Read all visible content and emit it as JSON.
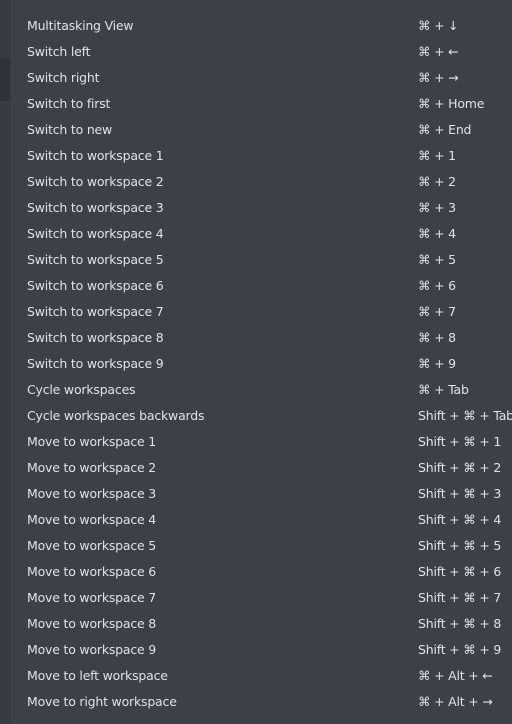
{
  "colors": {
    "background": "#3d4048",
    "text": "#dfe2e7",
    "sidebar_strip": "#383b41",
    "sidebar_block": "#303338"
  },
  "shortcuts": [
    {
      "action": "Multitasking View",
      "keys": "⌘ + ↓"
    },
    {
      "action": "Switch left",
      "keys": "⌘ + ←"
    },
    {
      "action": "Switch right",
      "keys": "⌘ + →"
    },
    {
      "action": "Switch to first",
      "keys": "⌘ + Home"
    },
    {
      "action": "Switch to new",
      "keys": "⌘ + End"
    },
    {
      "action": "Switch to workspace 1",
      "keys": "⌘ + 1"
    },
    {
      "action": "Switch to workspace 2",
      "keys": "⌘ + 2"
    },
    {
      "action": "Switch to workspace 3",
      "keys": "⌘ + 3"
    },
    {
      "action": "Switch to workspace 4",
      "keys": "⌘ + 4"
    },
    {
      "action": "Switch to workspace 5",
      "keys": "⌘ + 5"
    },
    {
      "action": "Switch to workspace 6",
      "keys": "⌘ + 6"
    },
    {
      "action": "Switch to workspace 7",
      "keys": "⌘ + 7"
    },
    {
      "action": "Switch to workspace 8",
      "keys": "⌘ + 8"
    },
    {
      "action": "Switch to workspace 9",
      "keys": "⌘ + 9"
    },
    {
      "action": "Cycle workspaces",
      "keys": "⌘ + Tab"
    },
    {
      "action": "Cycle workspaces backwards",
      "keys": "Shift + ⌘ + Tab"
    },
    {
      "action": "Move to workspace 1",
      "keys": "Shift + ⌘ + 1"
    },
    {
      "action": "Move to workspace 2",
      "keys": "Shift + ⌘ + 2"
    },
    {
      "action": "Move to workspace 3",
      "keys": "Shift + ⌘ + 3"
    },
    {
      "action": "Move to workspace 4",
      "keys": "Shift + ⌘ + 4"
    },
    {
      "action": "Move to workspace 5",
      "keys": "Shift + ⌘ + 5"
    },
    {
      "action": "Move to workspace 6",
      "keys": "Shift + ⌘ + 6"
    },
    {
      "action": "Move to workspace 7",
      "keys": "Shift + ⌘ + 7"
    },
    {
      "action": "Move to workspace 8",
      "keys": "Shift + ⌘ + 8"
    },
    {
      "action": "Move to workspace 9",
      "keys": "Shift + ⌘ + 9"
    },
    {
      "action": "Move to left workspace",
      "keys": "⌘ + Alt + ←"
    },
    {
      "action": "Move to right workspace",
      "keys": "⌘ + Alt + →"
    }
  ]
}
